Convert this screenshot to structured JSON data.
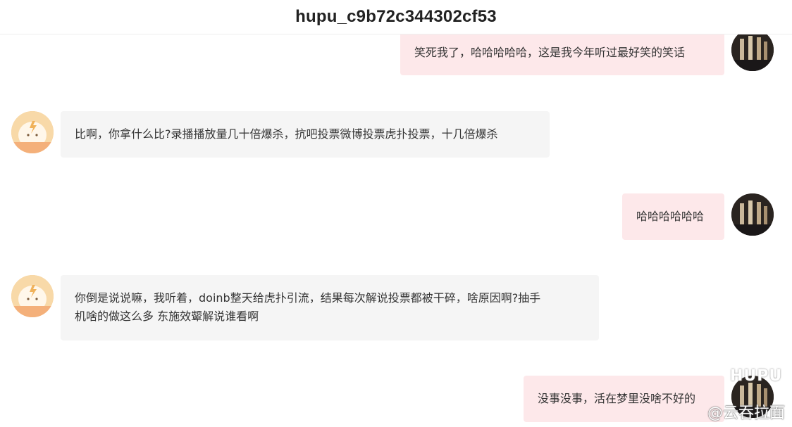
{
  "header": {
    "title": "hupu_c9b72c344302cf53"
  },
  "messages": [
    {
      "sender": "self",
      "text": "笑死我了，哈哈哈哈哈，这是我今年听过最好笑的笑话"
    },
    {
      "sender": "other",
      "text": "比啊，你拿什么比?录播播放量几十倍爆杀，抗吧投票微博投票虎扑投票，十几倍爆杀"
    },
    {
      "sender": "self",
      "text": "哈哈哈哈哈哈"
    },
    {
      "sender": "other",
      "text_line1": "你倒是说说嘛，我听着，doinb整天给虎扑引流，结果每次解说投票都被干碎，啥原因啊?抽手",
      "text_line2": "机啥的做这么多 东施效颦解说谁看啊"
    },
    {
      "sender": "self",
      "text": "没事没事，活在梦里没啥不好的"
    }
  ],
  "watermark": {
    "hupu": "HUPU",
    "author": "@云吞拉面"
  },
  "colors": {
    "self_bubble": "#fde8ea",
    "other_bubble": "#f5f5f5",
    "other_avatar": "#f7c98c"
  }
}
